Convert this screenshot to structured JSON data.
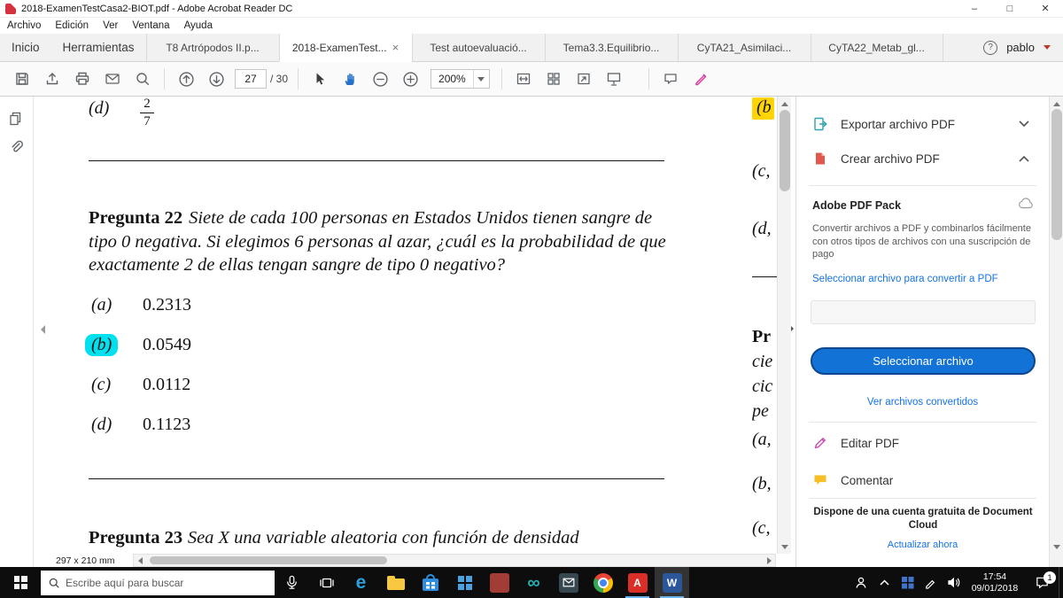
{
  "titlebar": {
    "title": "2018-ExamenTestCasa2-BIOT.pdf - Adobe Acrobat Reader DC",
    "controls": {
      "minimize": "–",
      "maximize": "□",
      "close": "✕"
    }
  },
  "menubar": {
    "items": [
      "Archivo",
      "Edición",
      "Ver",
      "Ventana",
      "Ayuda"
    ]
  },
  "tabbar": {
    "home": "Inicio",
    "tools": "Herramientas",
    "tabs": [
      {
        "label": "T8 Artrópodos II.p..."
      },
      {
        "label": "2018-ExamenTest..."
      },
      {
        "label": "Test autoevaluació..."
      },
      {
        "label": "Tema3.3.Equilibrio..."
      },
      {
        "label": "CyTA21_Asimilaci..."
      },
      {
        "label": "CyTA22_Metab_gl..."
      }
    ],
    "close_glyph": "×",
    "help_glyph": "?",
    "user": "pablo"
  },
  "toolbar": {
    "page_current": "27",
    "page_total_label": "/ 30",
    "zoom": "200%"
  },
  "document": {
    "prev_option_key": "(d)",
    "fraction_numerator": "2",
    "fraction_denominator": "7",
    "q22_label": "Pregunta 22",
    "q22_text": "Siete de cada 100 personas en Estados Unidos tienen sangre de tipo 0 negativa. Si elegimos 6 personas al azar, ¿cuál es la probabilidad de que exactamente 2 de ellas tengan sangre de tipo 0 negativo?",
    "options": [
      {
        "key": "(a)",
        "value": "0.2313"
      },
      {
        "key": "(b)",
        "value": "0.0549"
      },
      {
        "key": "(c)",
        "value": "0.0112"
      },
      {
        "key": "(d)",
        "value": "0.1123"
      }
    ],
    "q23_label": "Pregunta 23",
    "q23_text": "Sea X una variable aleatoria con función de densidad",
    "page_size": "297 x 210 mm",
    "column2": [
      "(b",
      "(c,",
      "(d,",
      "Pr",
      "cie",
      "cic",
      "pe",
      "(a,",
      "(b,",
      "(c,"
    ]
  },
  "panel": {
    "export_label": "Exportar archivo PDF",
    "create_label": "Crear archivo PDF",
    "pack_title": "Adobe PDF Pack",
    "pack_description": "Convertir archivos a PDF y combinarlos fácilmente con otros tipos de archivos con una suscripción de pago",
    "convert_link": "Seleccionar archivo para convertir a PDF",
    "select_button": "Seleccionar archivo",
    "converted_link": "Ver archivos convertidos",
    "edit_label": "Editar PDF",
    "comment_label": "Comentar",
    "cloud_notice": "Dispone de una cuenta gratuita de Document Cloud",
    "update_link": "Actualizar ahora"
  },
  "taskbar": {
    "search_placeholder": "Escribe aquí para buscar",
    "time": "17:54",
    "date": "09/01/2018",
    "notification_count": "1",
    "word_glyph": "W",
    "acrobat_glyph": "A",
    "edge_glyph": "e",
    "infinity_glyph": "∞"
  },
  "colors": {
    "accent_blue": "#1473e6",
    "highlight_cyan": "#00e0ef",
    "highlight_yellow": "#ffd400",
    "acrobat_red": "#d6313f"
  }
}
